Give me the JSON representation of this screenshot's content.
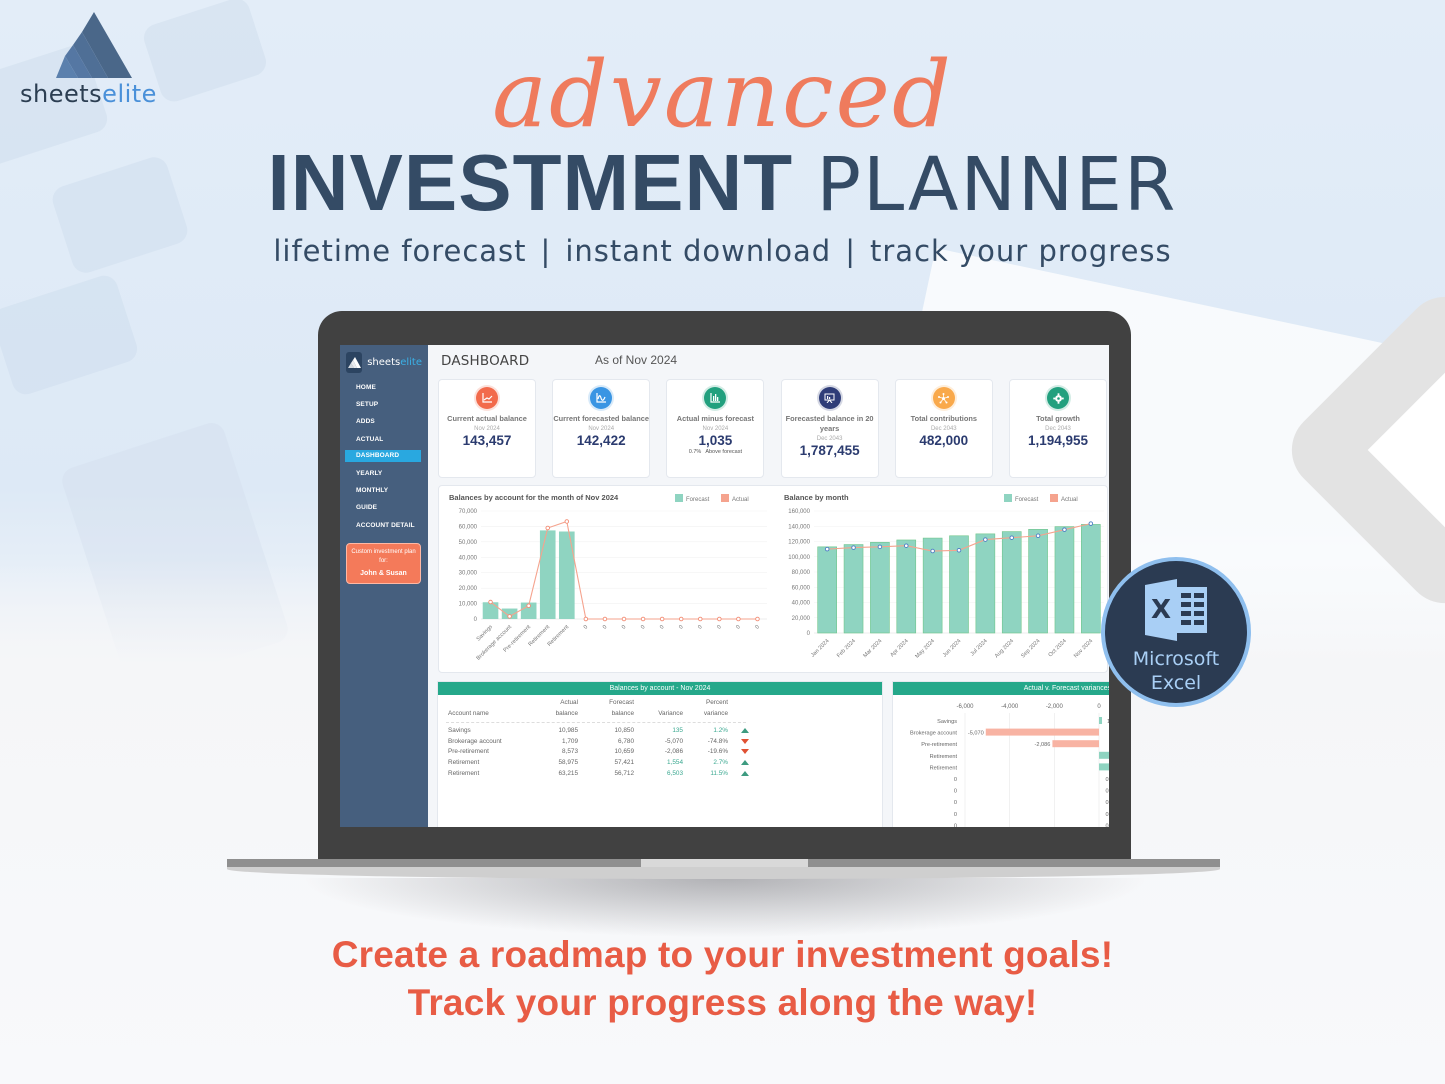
{
  "brand": {
    "name_part1": "sheets",
    "name_part2": "elite"
  },
  "hero": {
    "script_word": "advanced",
    "title_bold": "INVESTMENT",
    "title_light": "PLANNER",
    "features": [
      "lifetime forecast",
      "instant download",
      "track your progress"
    ],
    "separator": "|"
  },
  "colors": {
    "accent_orange": "#ef7b5d",
    "navy": "#344b65",
    "teal": "#25a88a",
    "forecast": "#8fd4c1",
    "actual": "#f5a38e"
  },
  "app": {
    "logo_part1": "sheets",
    "logo_part2": "elite",
    "nav": [
      {
        "label": "HOME",
        "active": false
      },
      {
        "label": "SETUP",
        "active": false
      },
      {
        "label": "ADDS",
        "active": false
      },
      {
        "label": "ACTUAL",
        "active": false
      },
      {
        "label": "DASHBOARD",
        "active": true
      },
      {
        "label": "YEARLY",
        "active": false
      },
      {
        "label": "MONTHLY",
        "active": false
      },
      {
        "label": "GUIDE",
        "active": false
      },
      {
        "label": "ACCOUNT DETAIL",
        "active": false
      }
    ],
    "plan_box": {
      "line1": "Custom investment plan for:",
      "name": "John & Susan"
    },
    "page_title": "DASHBOARD",
    "as_of": "As of Nov 2024"
  },
  "cards": [
    {
      "icon": "line-chart-icon",
      "color": "#f26a4b",
      "title": "Current actual balance",
      "date": "Nov 2024",
      "value": "143,457",
      "note": ""
    },
    {
      "icon": "wave-chart-icon",
      "color": "#3a95e3",
      "title": "Current forecasted balance",
      "date": "Nov 2024",
      "value": "142,422",
      "note": ""
    },
    {
      "icon": "bar-chart-icon",
      "color": "#22a07e",
      "title": "Actual minus forecast",
      "date": "Nov 2024",
      "value": "1,035",
      "note_pct": "0.7%",
      "note": "Above forecast"
    },
    {
      "icon": "presentation-icon",
      "color": "#2f3d78",
      "title": "Forecasted balance in 20 years",
      "date": "Dec 2043",
      "value": "1,787,455",
      "note": ""
    },
    {
      "icon": "network-icon",
      "color": "#f9a94b",
      "title": "Total contributions",
      "date": "Dec 2043",
      "value": "482,000",
      "note": ""
    },
    {
      "icon": "gear-icon",
      "color": "#22a07e",
      "title": "Total growth",
      "date": "Dec 2043",
      "value": "1,194,955",
      "note": ""
    }
  ],
  "chart_data": [
    {
      "type": "bar",
      "title": "Balances by account for the month of Nov 2024",
      "legend": [
        "Forecast",
        "Actual"
      ],
      "legend_position": "top-right",
      "categories": [
        "Savings",
        "Brokerage account",
        "Pre-retirement",
        "Retirement",
        "Retirement",
        "0",
        "0",
        "0",
        "0",
        "0",
        "0",
        "0",
        "0",
        "0",
        "0"
      ],
      "series": [
        {
          "name": "Forecast",
          "kind": "bar",
          "values": [
            10850,
            6780,
            10659,
            57421,
            56712,
            0,
            0,
            0,
            0,
            0,
            0,
            0,
            0,
            0,
            0
          ]
        },
        {
          "name": "Actual",
          "kind": "line",
          "values": [
            10985,
            1709,
            8573,
            58975,
            63215,
            0,
            0,
            0,
            0,
            0,
            0,
            0,
            0,
            0,
            0
          ]
        }
      ],
      "yticks": [
        "0",
        "10,000",
        "20,000",
        "30,000",
        "40,000",
        "50,000",
        "60,000",
        "70,000"
      ],
      "ylim": [
        0,
        70000
      ],
      "grid": true
    },
    {
      "type": "bar",
      "title": "Balance by month",
      "legend": [
        "Forecast",
        "Actual"
      ],
      "legend_position": "top-right",
      "categories": [
        "Jan 2024",
        "Feb 2024",
        "Mar 2024",
        "Apr 2024",
        "May 2024",
        "Jun 2024",
        "Jul 2024",
        "Aug 2024",
        "Sep 2024",
        "Oct 2024",
        "Nov 2024"
      ],
      "series": [
        {
          "name": "Forecast",
          "kind": "bar",
          "values": [
            113000,
            116000,
            119000,
            122000,
            124500,
            127500,
            130000,
            133000,
            136000,
            139500,
            142422
          ]
        },
        {
          "name": "Actual",
          "kind": "line",
          "values": [
            110000,
            112000,
            113000,
            114500,
            107500,
            108500,
            122500,
            125000,
            127500,
            135500,
            143457
          ]
        }
      ],
      "yticks": [
        "0",
        "20,000",
        "40,000",
        "60,000",
        "80,000",
        "100,000",
        "120,000",
        "140,000",
        "160,000"
      ],
      "ylim": [
        0,
        160000
      ],
      "grid": true
    },
    {
      "type": "bar",
      "orientation": "horizontal",
      "title": "Actual v. Forecast variances by account",
      "categories": [
        "Savings",
        "Brokerage account",
        "Pre-retirement",
        "Retirement",
        "Retirement",
        "0",
        "0",
        "0",
        "0",
        "0"
      ],
      "values": [
        135,
        -5070,
        -2086,
        1554,
        6503,
        0,
        0,
        0,
        0,
        0
      ],
      "value_labels": [
        "1",
        "-5,070",
        "-2,086",
        "",
        "",
        "0",
        "0",
        "0",
        "0",
        "0"
      ],
      "xticks": [
        "-6,000",
        "-4,000",
        "-2,000",
        "0"
      ],
      "xlim": [
        -6000,
        500
      ]
    }
  ],
  "table": {
    "title": "Balances by account - Nov 2024",
    "headers": {
      "account": "Account name",
      "actual_1": "Actual",
      "actual_2": "balance",
      "forecast_1": "Forecast",
      "forecast_2": "balance",
      "variance": "Variance",
      "pct_1": "Percent",
      "pct_2": "variance"
    },
    "rows": [
      {
        "name": "Savings",
        "actual": "10,985",
        "forecast": "10,850",
        "variance": "135",
        "pct": "1.2%",
        "dir": "up"
      },
      {
        "name": "Brokerage account",
        "actual": "1,709",
        "forecast": "6,780",
        "variance": "-5,070",
        "pct": "-74.8%",
        "dir": "down"
      },
      {
        "name": "Pre-retirement",
        "actual": "8,573",
        "forecast": "10,659",
        "variance": "-2,086",
        "pct": "-19.6%",
        "dir": "down"
      },
      {
        "name": "Retirement",
        "actual": "58,975",
        "forecast": "57,421",
        "variance": "1,554",
        "pct": "2.7%",
        "dir": "up"
      },
      {
        "name": "Retirement",
        "actual": "63,215",
        "forecast": "56,712",
        "variance": "6,503",
        "pct": "11.5%",
        "dir": "up"
      }
    ]
  },
  "variance_panel_title": "Actual v. Forecast variances b",
  "excel_badge": {
    "line1": "Microsoft",
    "line2": "Excel"
  },
  "cta": {
    "line1": "Create a roadmap to your investment goals!",
    "line2": "Track your progress along the way!"
  }
}
